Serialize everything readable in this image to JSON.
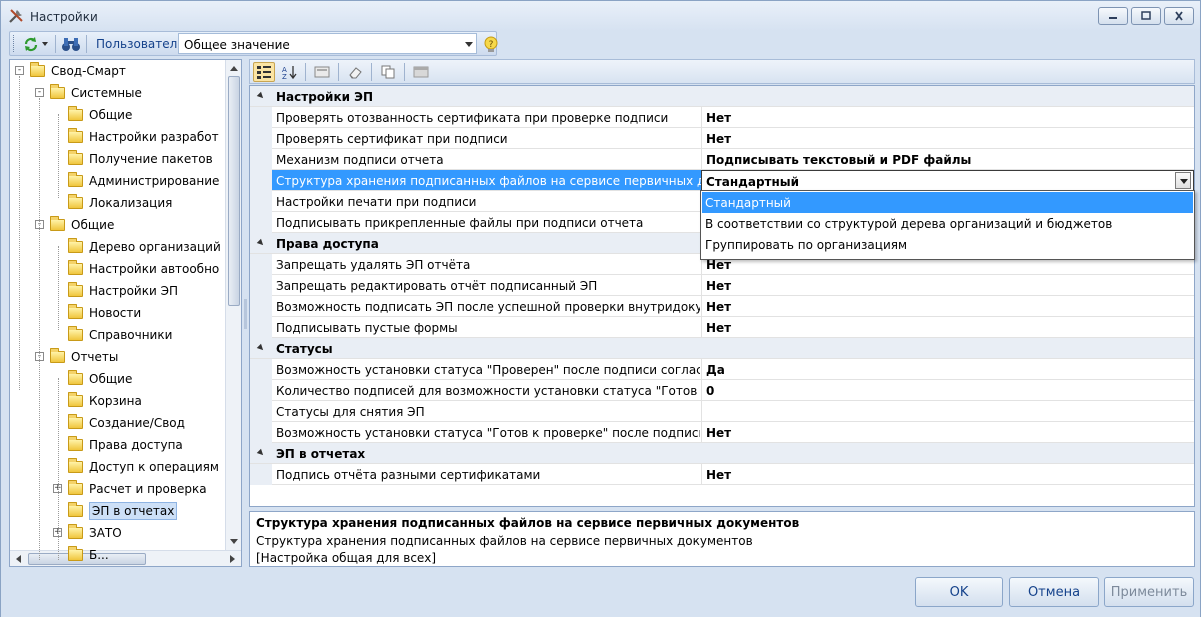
{
  "window": {
    "title": "Настройки"
  },
  "toolbar": {
    "user_label": "Пользователь",
    "scope_value": "Общее значение"
  },
  "tree": [
    {
      "label": "Свод-Смарт",
      "level": 0,
      "expander": "-"
    },
    {
      "label": "Системные",
      "level": 1,
      "expander": "-"
    },
    {
      "label": "Общие",
      "level": 2
    },
    {
      "label": "Настройки разработ",
      "level": 2
    },
    {
      "label": "Получение пакетов",
      "level": 2
    },
    {
      "label": "Администрирование",
      "level": 2
    },
    {
      "label": "Локализация",
      "level": 2
    },
    {
      "label": "Общие",
      "level": 1,
      "expander": "-"
    },
    {
      "label": "Дерево организаций",
      "level": 2
    },
    {
      "label": "Настройки автообно",
      "level": 2
    },
    {
      "label": "Настройки ЭП",
      "level": 2
    },
    {
      "label": "Новости",
      "level": 2
    },
    {
      "label": "Справочники",
      "level": 2
    },
    {
      "label": "Отчеты",
      "level": 1,
      "expander": "-"
    },
    {
      "label": "Общие",
      "level": 2
    },
    {
      "label": "Корзина",
      "level": 2
    },
    {
      "label": "Создание/Свод",
      "level": 2
    },
    {
      "label": "Права доступа",
      "level": 2
    },
    {
      "label": "Доступ к операциям",
      "level": 2
    },
    {
      "label": "Расчет и проверка",
      "level": 2,
      "expander": "+"
    },
    {
      "label": "ЭП в отчетах",
      "level": 2,
      "selected": true
    },
    {
      "label": "ЗАТО",
      "level": 2,
      "expander": "+"
    },
    {
      "label": "Б...",
      "level": 2
    }
  ],
  "grid": {
    "rows": [
      {
        "type": "category",
        "name": "Настройки ЭП"
      },
      {
        "name": "Проверять отозванность сертификата при проверке подписи",
        "value": "Нет"
      },
      {
        "name": "Проверять сертификат при подписи",
        "value": "Нет"
      },
      {
        "name": "Механизм подписи отчета",
        "value": "Подписывать текстовый и PDF файлы"
      },
      {
        "name": "Структура хранения подписанных файлов на сервисе первичных документов",
        "value": "Стандартный",
        "selected": true
      },
      {
        "name": "Настройки печати при подписи",
        "value": ""
      },
      {
        "name": "Подписывать прикрепленные файлы при подписи отчета",
        "value": ""
      },
      {
        "type": "category",
        "name": "Права доступа"
      },
      {
        "name": "Запрещать удалять ЭП отчёта",
        "value": "Нет"
      },
      {
        "name": "Запрещать редактировать отчёт подписанный ЭП",
        "value": "Нет"
      },
      {
        "name": "Возможность подписать ЭП после успешной проверки внутридокументных контролей",
        "value": "Нет"
      },
      {
        "name": "Подписывать пустые формы",
        "value": "Нет"
      },
      {
        "type": "category",
        "name": "Статусы"
      },
      {
        "name": "Возможность установки статуса \"Проверен\" после подписи согласно",
        "value": "Да"
      },
      {
        "name": "Количество подписей для возможности установки статуса \"Готов к проверке\"",
        "value": "0"
      },
      {
        "name": "Статусы для снятия ЭП",
        "value": ""
      },
      {
        "name": "Возможность установки статуса \"Готов к проверке\" после подписи",
        "value": "Нет"
      },
      {
        "type": "category",
        "name": "ЭП в отчетах"
      },
      {
        "name": "Подпись отчёта разными сертификатами",
        "value": "Нет"
      }
    ],
    "dropdown_options": [
      {
        "label": "Стандартный",
        "highlighted": true
      },
      {
        "label": "В соответствии со структурой дерева организаций и бюджетов"
      },
      {
        "label": "Группировать по организациям"
      }
    ]
  },
  "description": {
    "title": "Структура хранения подписанных файлов на сервисе первичных документов",
    "line1": "Структура хранения подписанных файлов на сервисе первичных документов",
    "line2": "[Настройка общая для всех]"
  },
  "footer": {
    "ok": "OK",
    "cancel": "Отмена",
    "apply": "Применить"
  }
}
